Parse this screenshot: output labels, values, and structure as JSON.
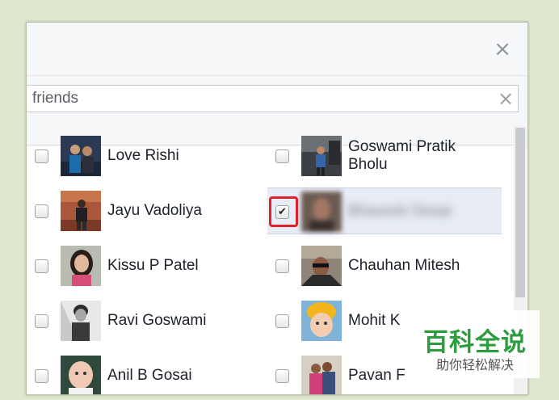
{
  "dialog": {
    "close_symbol": "×",
    "search": {
      "value": "friends",
      "clear_symbol": "×"
    },
    "check_symbol": "✔",
    "friends_left": [
      {
        "name": "Love Rishi",
        "checked": false
      },
      {
        "name": "Jayu Vadoliya",
        "checked": false
      },
      {
        "name": "Kissu P Patel",
        "checked": false
      },
      {
        "name": "Ravi Goswami",
        "checked": false
      },
      {
        "name": "Anil B Gosai",
        "checked": false
      }
    ],
    "friends_right": [
      {
        "name": "Goswami Pratik Bholu",
        "checked": false
      },
      {
        "name": "Bhavesh Desai",
        "checked": true,
        "blurred": true
      },
      {
        "name": "Chauhan Mitesh",
        "checked": false
      },
      {
        "name": "Mohit K",
        "checked": false
      },
      {
        "name": "Pavan F",
        "checked": false
      }
    ]
  },
  "watermark": {
    "title": "百科全说",
    "subtitle": "助你轻松解决"
  },
  "colors": {
    "page_bg": "#dde8cf",
    "highlight": "#e0202a",
    "selected_row": "#e7ecf5",
    "watermark_green": "#2d9c3e"
  }
}
